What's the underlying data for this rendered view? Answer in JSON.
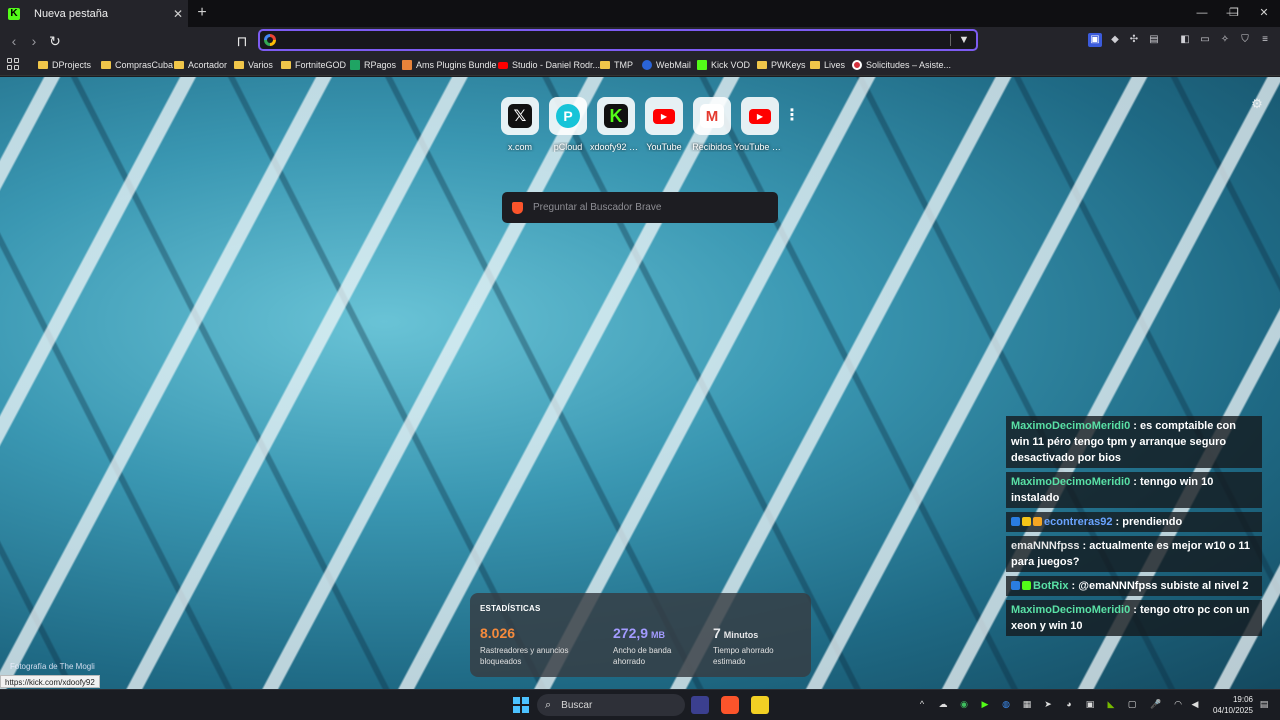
{
  "browser": {
    "tab_title": "Nueva pestaña",
    "tab_close": "✕",
    "new_tab": "+",
    "window_controls": [
      "—",
      "❐",
      "✕"
    ],
    "url_value": "",
    "url_placeholder": ""
  },
  "bookmarks": [
    {
      "label": "DProjects",
      "icon": "folder"
    },
    {
      "label": "ComprasCuba",
      "icon": "folder"
    },
    {
      "label": "Acortador",
      "icon": "folder"
    },
    {
      "label": "Varios",
      "icon": "folder"
    },
    {
      "label": "FortniteGOD",
      "icon": "folder"
    },
    {
      "label": "RPagos",
      "icon": "sheet"
    },
    {
      "label": "Ams Plugins Bundle",
      "icon": "ams"
    },
    {
      "label": "Studio - Daniel Rodr...",
      "icon": "yt"
    },
    {
      "label": "TMP",
      "icon": "folder"
    },
    {
      "label": "WebMail",
      "icon": "webmail"
    },
    {
      "label": "Kick VOD",
      "icon": "kick"
    },
    {
      "label": "PWKeys",
      "icon": "folder"
    },
    {
      "label": "Lives",
      "icon": "folder"
    },
    {
      "label": "Solicitudes – Asiste...",
      "icon": "sol"
    }
  ],
  "top_sites": [
    {
      "label": "x.com",
      "glyph": "𝕏",
      "kind": "g-x"
    },
    {
      "label": "pCloud",
      "glyph": "P",
      "kind": "g-p"
    },
    {
      "label": "xdoofy92 S...",
      "glyph": "K",
      "kind": "g-k"
    },
    {
      "label": "YouTube",
      "glyph": "▶",
      "kind": "g-yt"
    },
    {
      "label": "Recibidos",
      "glyph": "M",
      "kind": "g-gm"
    },
    {
      "label": "YouTube St...",
      "glyph": "▶",
      "kind": "g-yt"
    }
  ],
  "search": {
    "placeholder": "Preguntar al Buscador Brave"
  },
  "chat": [
    {
      "user": "MaximoDecimoMeridi0",
      "user_style": "green",
      "text": "es comptaible con win 11 péro tengo tpm y arranque seguro desactivado por bios",
      "badges": []
    },
    {
      "user": "MaximoDecimoMeridi0",
      "user_style": "green",
      "text": "tenngo win 10 instalado",
      "badges": []
    },
    {
      "user": "econtreras92",
      "user_style": "blue",
      "text": "prendiendo",
      "badges": [
        "#2a7de1",
        "#f5c518",
        "#f5a623"
      ]
    },
    {
      "user": "emaNNNfpss",
      "user_style": "plain",
      "text": "actualmente es mejor w10 o 11 para juegos?",
      "badges": []
    },
    {
      "user": "BotRix",
      "user_style": "green",
      "text": "@emaNNNfpss subiste al nivel 2",
      "badges": [
        "#2a7de1",
        "#53fc18"
      ]
    },
    {
      "user": "MaximoDecimoMeridi0",
      "user_style": "green",
      "text": "tengo otro pc con un xeon y win 10",
      "badges": []
    }
  ],
  "stats": {
    "header": "ESTADÍSTICAS",
    "items": [
      {
        "num": "8.026",
        "unit": "",
        "desc": "Rastreadores y anuncios bloqueados",
        "color": "#f58a3c"
      },
      {
        "num": "272,9",
        "unit": "MB",
        "desc": "Ancho de banda ahorrado",
        "color": "#a39bff"
      },
      {
        "num": "7",
        "unit": "Minutos",
        "desc": "Tiempo ahorrado estimado",
        "color": "#ffffff"
      }
    ]
  },
  "photo_credit": "Fotografía de The Mogli",
  "status_url": "https://kick.com/xdoofy92",
  "taskbar": {
    "search_label": "Buscar",
    "time": "19:06",
    "date": "04/10/2025"
  },
  "colors": {
    "accent": "#7d5cf2",
    "kick": "#53fc18",
    "brave": "#fb542b"
  }
}
